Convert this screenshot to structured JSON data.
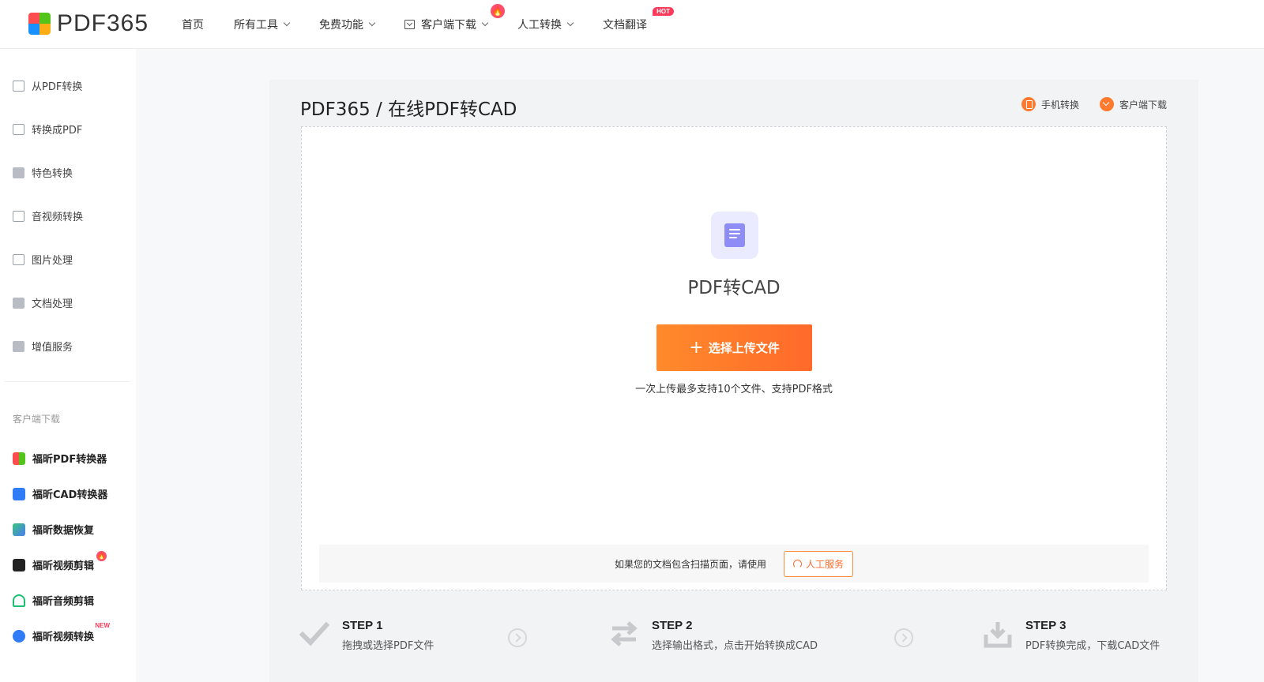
{
  "header": {
    "logo_text": "PDF365",
    "nav": [
      {
        "label": "首页"
      },
      {
        "label": "所有工具"
      },
      {
        "label": "免费功能"
      },
      {
        "label": "客户端下载"
      },
      {
        "label": "人工转换"
      },
      {
        "label": "文档翻译",
        "badge": "HOT"
      }
    ]
  },
  "sidebar": {
    "categories": [
      {
        "label": "从PDF转换"
      },
      {
        "label": "转换成PDF"
      },
      {
        "label": "特色转换"
      },
      {
        "label": "音视频转换"
      },
      {
        "label": "图片处理"
      },
      {
        "label": "文档处理"
      },
      {
        "label": "增值服务"
      }
    ],
    "section_title": "客户端下载",
    "apps": [
      {
        "label": "福昕PDF转换器"
      },
      {
        "label": "福昕CAD转换器"
      },
      {
        "label": "福昕数据恢复"
      },
      {
        "label": "福昕视频剪辑"
      },
      {
        "label": "福昕音频剪辑"
      },
      {
        "label": "福昕视频转换",
        "badge": "NEW"
      }
    ]
  },
  "main": {
    "breadcrumb": "PDF365 / 在线PDF转CAD",
    "actions": {
      "mobile": "手机转换",
      "download": "客户端下载"
    },
    "tool_title": "PDF转CAD",
    "upload_button": "选择上传文件",
    "upload_hint": "一次上传最多支持10个文件、支持PDF格式",
    "scan_text": "如果您的文档包含扫描页面，请使用",
    "service_button": "人工服务"
  },
  "steps": [
    {
      "title": "STEP 1",
      "desc": "拖拽或选择PDF文件"
    },
    {
      "title": "STEP 2",
      "desc": "选择输出格式，点击开始转换成CAD"
    },
    {
      "title": "STEP 3",
      "desc": "PDF转换完成，下载CAD文件"
    }
  ],
  "colors": {
    "accent": "#ff6a2a",
    "hot": "#ff3b5c",
    "file_icon": "#8e8cf5"
  }
}
